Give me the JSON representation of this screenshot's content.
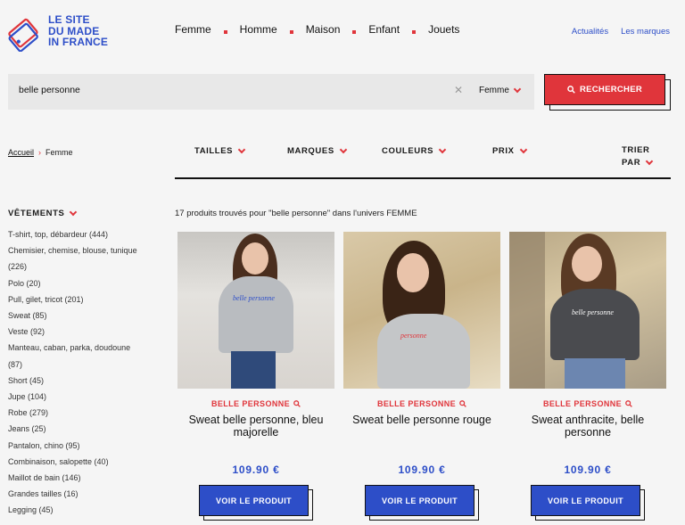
{
  "logo": {
    "lines": [
      "LE SITE",
      "DU MADE",
      "IN FRANCE"
    ]
  },
  "nav": {
    "items": [
      "Femme",
      "Homme",
      "Maison",
      "Enfant",
      "Jouets"
    ]
  },
  "top_links": [
    "Actualités",
    "Les marques"
  ],
  "search": {
    "value": "belle personne",
    "universe": "Femme",
    "button_label": "RECHERCHER"
  },
  "breadcrumb": [
    "Accueil",
    "Femme"
  ],
  "filters": [
    "TAILLES",
    "MARQUES",
    "COULEURS",
    "PRIX"
  ],
  "sort": {
    "line1": "TRIER",
    "line2": "PAR"
  },
  "sidebar": {
    "title": "VÊTEMENTS",
    "categories": [
      "T-shirt, top, débardeur (444)",
      "Chemisier, chemise, blouse, tunique",
      "(226)",
      "Polo (20)",
      "Pull, gilet, tricot (201)",
      "Sweat (85)",
      "Veste (92)",
      "Manteau, caban, parka, doudoune",
      "(87)",
      "Short (45)",
      "Jupe (104)",
      "Robe (279)",
      "Jeans (25)",
      "Pantalon, chino (95)",
      "Combinaison, salopette (40)",
      "Maillot de bain (146)",
      "Grandes tailles (16)",
      "Legging (45)"
    ]
  },
  "results": {
    "count_text": "17 produits trouvés pour \"belle personne\" dans l'univers FEMME"
  },
  "products": [
    {
      "brand": "BELLE PERSONNE",
      "name": "Sweat belle personne, bleu majorelle",
      "price": "109.90 €",
      "cta": "VOIR LE PRODUIT",
      "chest": "belle personne"
    },
    {
      "brand": "BELLE PERSONNE",
      "name": "Sweat belle personne rouge",
      "price": "109.90 €",
      "cta": "VOIR LE PRODUIT",
      "chest": "personne"
    },
    {
      "brand": "BELLE PERSONNE",
      "name": "Sweat anthracite, belle personne",
      "price": "109.90 €",
      "cta": "VOIR LE PRODUIT",
      "chest": "belle personne"
    }
  ],
  "colors": {
    "brand_blue": "#2d4ec8",
    "accent_red": "#e0353b",
    "background": "#f5f5f5"
  }
}
